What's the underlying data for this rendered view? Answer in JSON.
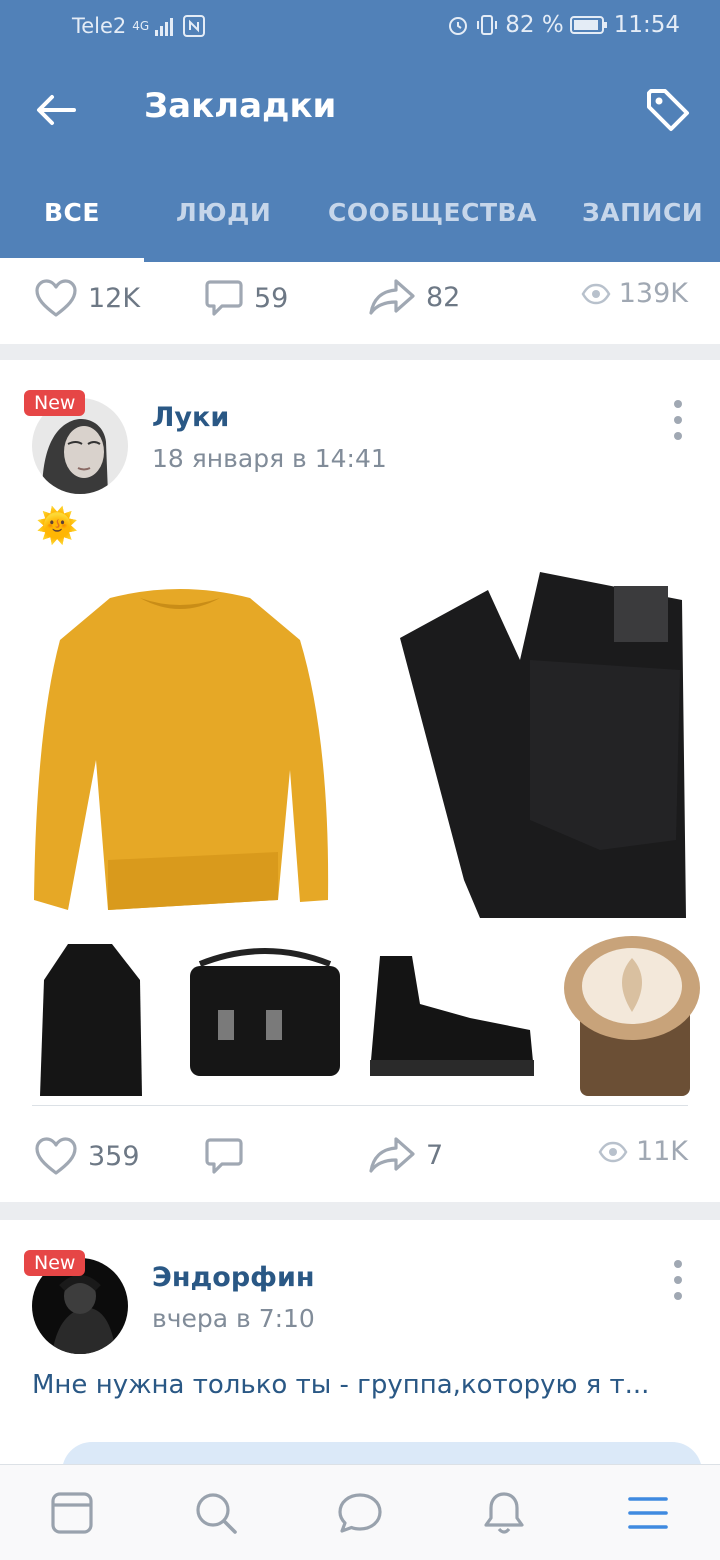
{
  "status_bar": {
    "carrier": "Tele2",
    "network": "4G",
    "battery": "82 %",
    "time": "11:54"
  },
  "header": {
    "title": "Закладки"
  },
  "tabs": [
    {
      "label": "ВСЕ",
      "active": true
    },
    {
      "label": "ЛЮДИ",
      "active": false
    },
    {
      "label": "СООБЩЕСТВА",
      "active": false
    },
    {
      "label": "ЗАПИСИ",
      "active": false
    }
  ],
  "posts": [
    {
      "likes": "12K",
      "comments": "59",
      "shares": "82",
      "views": "139K"
    },
    {
      "badge": "New",
      "author": "Луки",
      "date": "18 января в 14:41",
      "emoji": "🌞",
      "likes": "359",
      "comments": "",
      "shares": "7",
      "views": "11K"
    },
    {
      "badge": "New",
      "author": "Эндорфин",
      "date": "вчера в 7:10",
      "text": "Мне нужна только ты - группа,которую я т..."
    }
  ],
  "colors": {
    "header": "#5181b8",
    "link": "#2a5885",
    "badge": "#e64646",
    "nav_active": "#3f8ae0"
  },
  "bottom_nav": [
    {
      "icon": "feed-icon"
    },
    {
      "icon": "search-icon"
    },
    {
      "icon": "messages-icon"
    },
    {
      "icon": "bell-icon"
    },
    {
      "icon": "menu-icon",
      "active": true
    }
  ]
}
